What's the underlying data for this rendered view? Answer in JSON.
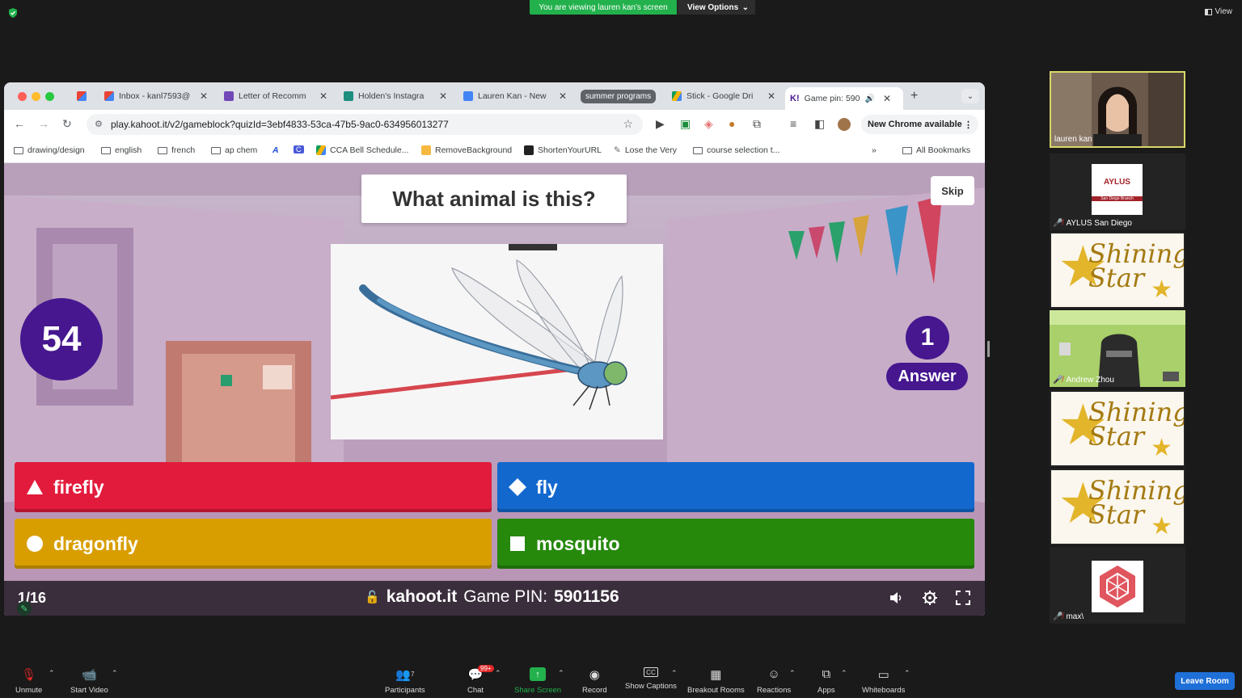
{
  "zoom": {
    "viewing_banner": "You are viewing lauren kan's screen",
    "view_options": "View Options",
    "view_top_right": "View",
    "leave_button": "Leave Room",
    "toolbar": {
      "unmute": "Unmute",
      "start_video": "Start Video",
      "participants": "Participants",
      "participants_count": "7",
      "chat": "Chat",
      "chat_badge": "99+",
      "share_screen": "Share Screen",
      "record": "Record",
      "show_captions": "Show Captions",
      "breakout_rooms": "Breakout Rooms",
      "reactions": "Reactions",
      "apps": "Apps",
      "whiteboards": "Whiteboards"
    },
    "participants": [
      {
        "name": "lauren kan"
      },
      {
        "name": "AYLUS San Diego",
        "logo_text": "AYLUS",
        "logo_sub": "San Diego Branch"
      },
      {
        "name": "",
        "logo_text": "Shining Star"
      },
      {
        "name": "Andrew Zhou"
      },
      {
        "name": "",
        "logo_text": "Shining Star"
      },
      {
        "name": "",
        "logo_text": "Shining Star"
      },
      {
        "name": "max\\"
      }
    ]
  },
  "browser": {
    "tabs": [
      {
        "label": "",
        "icon": "gmail-icon"
      },
      {
        "label": "Inbox - kanl7593@",
        "icon": "gmail-icon"
      },
      {
        "label": "Letter of Recomm",
        "icon": "forms-icon"
      },
      {
        "label": "Holden's Instagra",
        "icon": "classroom-icon"
      },
      {
        "label": "Lauren Kan - New",
        "icon": "docs-icon"
      },
      {
        "label": "summer programs",
        "icon": "tab-group"
      },
      {
        "label": "Stick - Google Dri",
        "icon": "drive-icon"
      },
      {
        "label": "Game pin: 590",
        "icon": "kahoot-icon"
      }
    ],
    "url": "play.kahoot.it/v2/gameblock?quizId=3ebf4833-53ca-47b5-9ac0-634956013277",
    "new_chrome": "New Chrome available",
    "bookmarks": [
      "drawing/design",
      "english",
      "french",
      "ap chem",
      "",
      "",
      "CCA Bell Schedule...",
      "RemoveBackground",
      "ShortenYourURL",
      "Lose the Very",
      "course selection t..."
    ],
    "all_bookmarks": "All Bookmarks"
  },
  "kahoot": {
    "question": "What animal is this?",
    "skip": "Skip",
    "timer": "54",
    "answers_count": "1",
    "answers_label": "Answer",
    "options": [
      {
        "label": "firefly",
        "shape": "triangle",
        "color": "#e21b3c"
      },
      {
        "label": "fly",
        "shape": "diamond",
        "color": "#1368ce"
      },
      {
        "label": "dragonfly",
        "shape": "circle",
        "color": "#d89e00"
      },
      {
        "label": "mosquito",
        "shape": "square",
        "color": "#26890c"
      }
    ],
    "question_number": "1/16",
    "site": "kahoot.it",
    "pin_label": "Game PIN:",
    "pin": "5901156"
  }
}
